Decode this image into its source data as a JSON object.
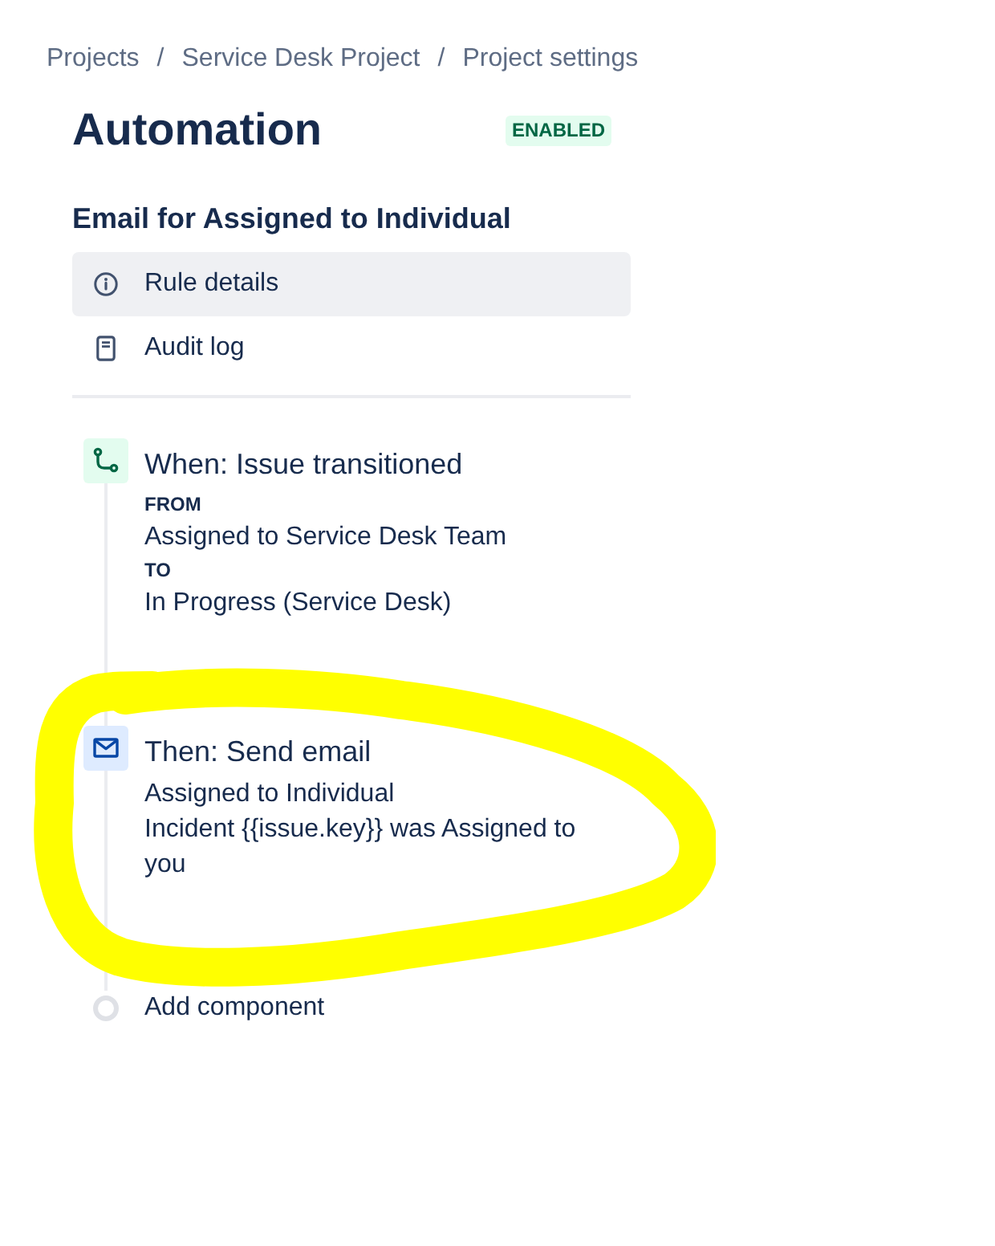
{
  "breadcrumbs": [
    {
      "label": "Projects",
      "separator": "/"
    },
    {
      "label": "Service Desk Project",
      "separator": "/"
    },
    {
      "label": "Project settings"
    }
  ],
  "page_title": "Automation",
  "status_badge": "ENABLED",
  "rule_name": "Email for Assigned to Individual",
  "nav_items": [
    {
      "kind": "details",
      "label": "Rule details",
      "selected": true
    },
    {
      "kind": "audit",
      "label": "Audit log",
      "selected": false
    }
  ],
  "components": [
    {
      "kind": "trigger",
      "title": "When: Issue transitioned",
      "details": [
        {
          "kind": "label",
          "text": "FROM"
        },
        {
          "kind": "value",
          "text": "Assigned to Service Desk Team"
        },
        {
          "kind": "label",
          "text": "TO"
        },
        {
          "kind": "value",
          "text": "In Progress (Service Desk)"
        }
      ]
    },
    {
      "kind": "action",
      "title": "Then: Send email",
      "details": [
        {
          "kind": "value",
          "text": "Assigned to Individual"
        },
        {
          "kind": "value",
          "text": "Incident {{issue.key}} was Assigned to you"
        }
      ]
    }
  ],
  "add_component": "Add component"
}
